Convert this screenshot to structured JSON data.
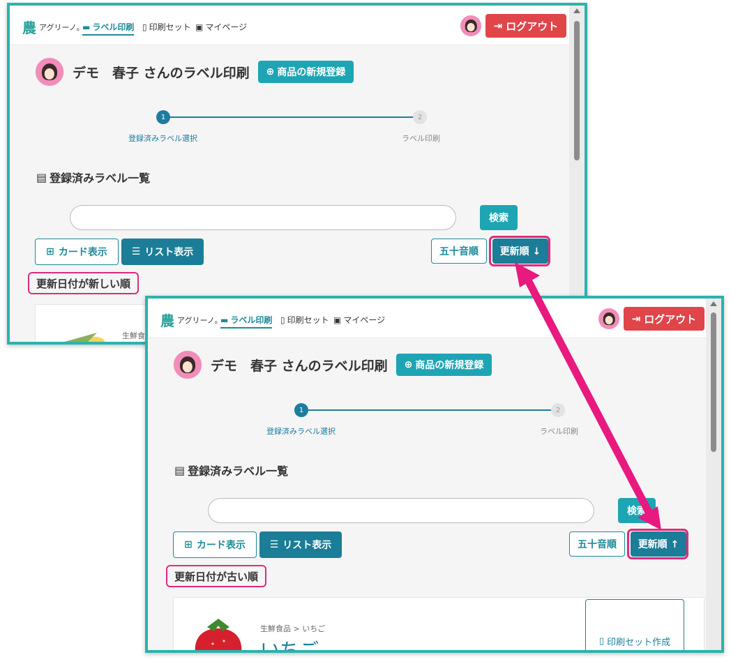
{
  "colors": {
    "accent": "#1ea5b4",
    "primary": "#1b7d97",
    "logout": "#e0454a",
    "highlight": "#e02a7d",
    "frame": "#2bb3ad"
  },
  "nav": {
    "logo_text": "アグリーノ。",
    "links": [
      "ラベル印刷",
      "印刷セット",
      "マイページ"
    ],
    "logout_label": "ログアウト"
  },
  "header": {
    "title": "デモ　春子 さんのラベル印刷",
    "new_product_label": "商品の新規登録"
  },
  "stepper": {
    "steps": [
      {
        "num": "1",
        "label": "登録済みラベル選択"
      },
      {
        "num": "2",
        "label": "ラベル印刷"
      }
    ]
  },
  "list": {
    "section_title": "登録済みラベル一覧",
    "search_placeholder": "",
    "search_label": "検索",
    "card_view_label": "カード表示",
    "list_view_label": "リスト表示",
    "sort_kana_label": "五十音順"
  },
  "screen1": {
    "sort_date_label": "更新順 ↓",
    "order_label": "更新日付が新しい順",
    "product_category": "生鮮食品"
  },
  "screen2": {
    "sort_date_label": "更新順 ↑",
    "order_label": "更新日付が古い順",
    "product_category": "生鮮食品 > いちご",
    "product_name": "いちご",
    "print_set_label": "印刷セット作成"
  },
  "icons": [
    "logo-mark-icon",
    "printer-icon",
    "bookmark-icon",
    "mypage-icon",
    "avatar-icon",
    "logout-icon",
    "plus-circle-icon",
    "list-doc-icon",
    "grid-icon",
    "list-icon",
    "corn-image",
    "strawberry-image",
    "scroll-up-icon"
  ]
}
